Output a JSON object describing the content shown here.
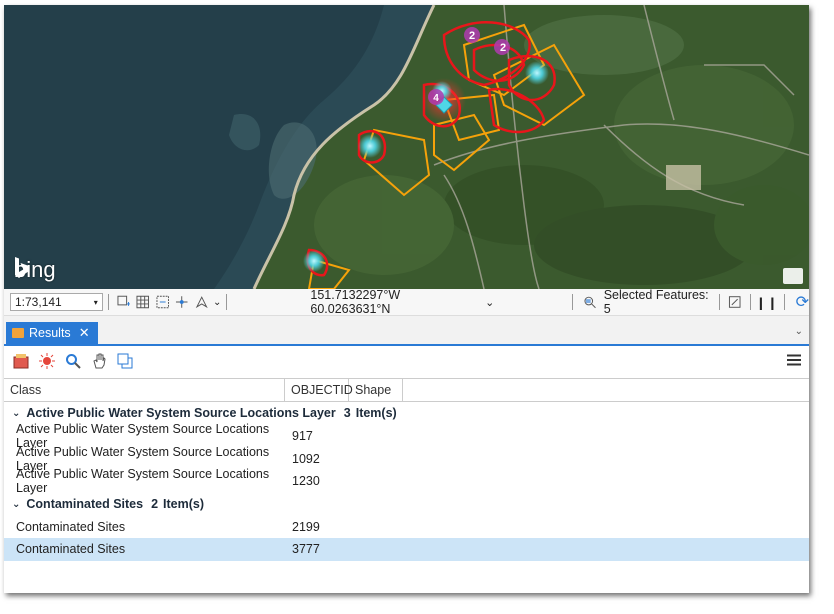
{
  "map": {
    "brand_text": "bing",
    "cluster_counts": [
      "2",
      "2",
      "4"
    ]
  },
  "status": {
    "scale_value": "1:73,141",
    "coordinates": "151.7132297°W 60.0263631°N",
    "selected_features": "Selected Features: 5"
  },
  "results_tab": {
    "label": "Results",
    "close": "✕"
  },
  "grid": {
    "columns": [
      "Class",
      "OBJECTID",
      "Shape"
    ],
    "groups": [
      {
        "name": "Active Public Water System Source Locations Layer",
        "count": "3",
        "count_label": "Item(s)",
        "rows": [
          {
            "class": "Active Public Water System Source Locations Layer",
            "objectid": "917"
          },
          {
            "class": "Active Public Water System Source Locations Layer",
            "objectid": "1092"
          },
          {
            "class": "Active Public Water System Source Locations Layer",
            "objectid": "1230"
          }
        ]
      },
      {
        "name": "Contaminated Sites",
        "count": "2",
        "count_label": "Item(s)",
        "rows": [
          {
            "class": "Contaminated Sites",
            "objectid": "2199"
          },
          {
            "class": "Contaminated Sites",
            "objectid": "3777",
            "selected": true
          }
        ]
      }
    ]
  },
  "colors": {
    "accent": "#2a7ad5",
    "selection": "#cce4f7",
    "polygon_red": "#e8161b",
    "polygon_orange": "#f5a20a",
    "point_cyan": "#4fd6e6"
  }
}
